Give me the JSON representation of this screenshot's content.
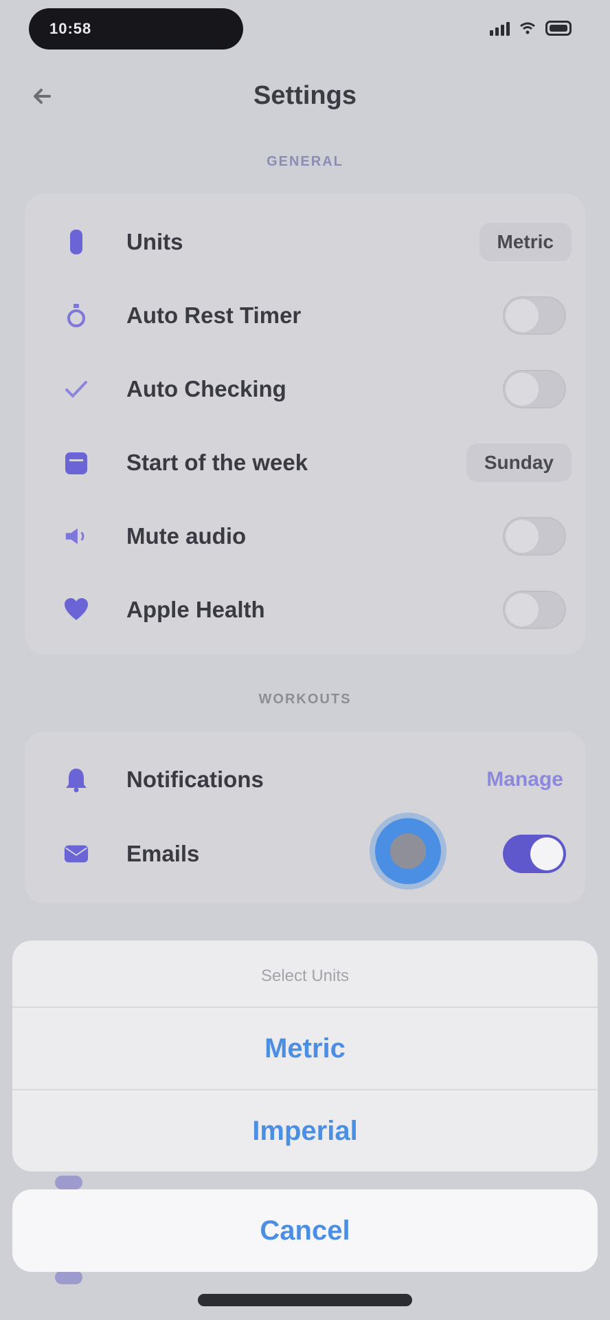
{
  "status_bar": {
    "time": "10:58"
  },
  "nav": {
    "title": "Settings"
  },
  "sections": {
    "general_header": "GENERAL",
    "workouts_header": "WORKOUTS"
  },
  "general_rows": [
    {
      "label": "Units",
      "value": "Metric",
      "icon": "ruler-icon"
    },
    {
      "label": "Auto Rest Timer",
      "toggle": false,
      "icon": "timer-icon"
    },
    {
      "label": "Auto Checking",
      "toggle": false,
      "icon": "checkmark-icon"
    },
    {
      "label": "Start of the week",
      "value": "Sunday",
      "icon": "calendar-icon"
    },
    {
      "label": "Mute audio",
      "toggle": false,
      "icon": "speaker-icon"
    },
    {
      "label": "Apple Health",
      "toggle": false,
      "icon": "heart-icon"
    }
  ],
  "notification_rows": [
    {
      "label": "Notifications",
      "link": "Manage",
      "icon": "bell-icon"
    },
    {
      "label": "Emails",
      "toggle": true,
      "icon": "mail-icon"
    }
  ],
  "action_sheet": {
    "title": "Select Units",
    "options": [
      "Metric",
      "Imperial"
    ],
    "cancel": "Cancel"
  },
  "colors": {
    "accent": "#5f58cc",
    "sheet_text": "#4a8fe3"
  }
}
